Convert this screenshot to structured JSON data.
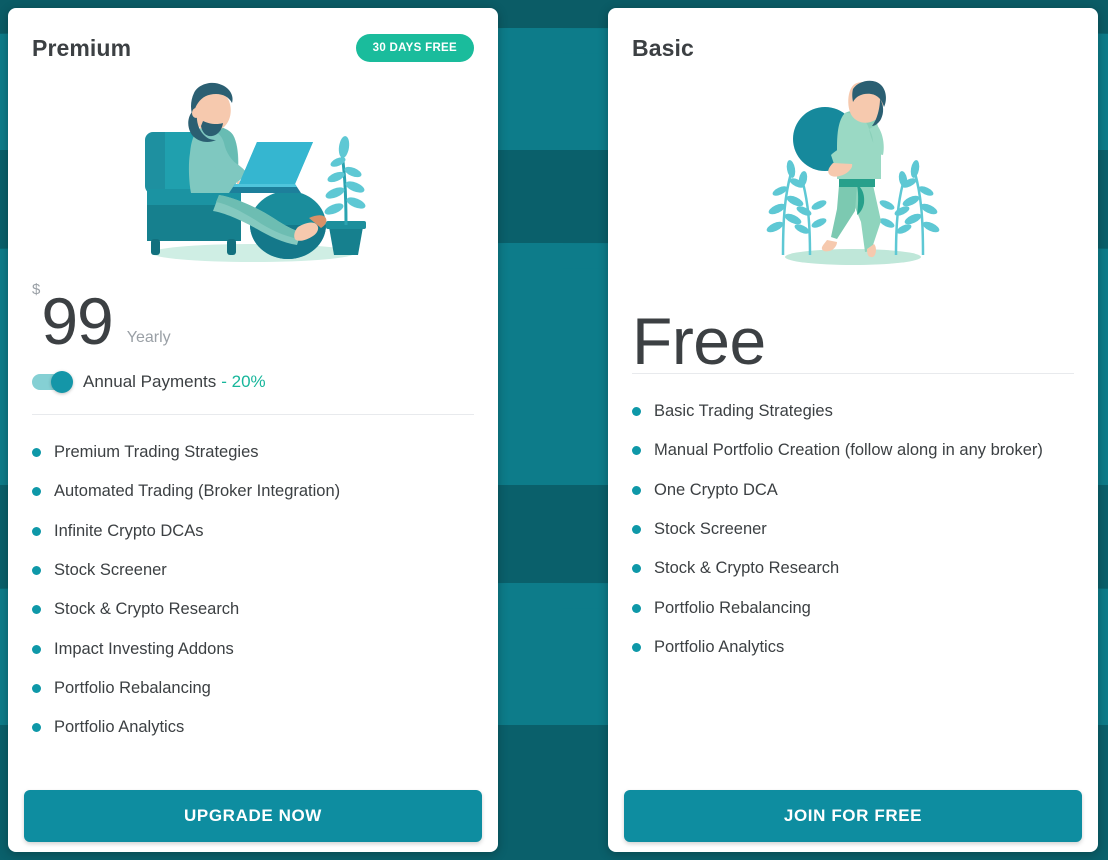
{
  "background": {
    "base_color": "#0b5c66",
    "band_light_color": "#0d7c8a",
    "band_dark_color": "#0a606b"
  },
  "theme": {
    "accent_teal": "#0e98a8",
    "badge_green": "#1abc9c",
    "button_teal": "#0e8da0",
    "discount_green": "#17b69b",
    "text_dark": "#3c4043",
    "text_muted": "#9aa0a6"
  },
  "plans": [
    {
      "id": "premium",
      "title": "Premium",
      "badge": "30 DAYS FREE",
      "illustration": "man-in-armchair-with-laptop-illustration",
      "price": {
        "currency": "$",
        "amount": "99",
        "period": "Yearly"
      },
      "toggle": {
        "label": "Annual Payments",
        "discount": "- 20%",
        "state": "on"
      },
      "features": [
        "Premium Trading Strategies",
        "Automated Trading (Broker Integration)",
        "Infinite Crypto DCAs",
        "Stock Screener",
        "Stock & Crypto Research",
        "Impact Investing Addons",
        "Portfolio Rebalancing",
        "Portfolio Analytics"
      ],
      "cta": "UPGRADE NOW"
    },
    {
      "id": "basic",
      "title": "Basic",
      "badge": null,
      "illustration": "person-carrying-ball-with-plants-illustration",
      "price": {
        "currency": "",
        "amount": "Free",
        "period": ""
      },
      "toggle": null,
      "features": [
        "Basic Trading Strategies",
        "Manual Portfolio Creation (follow along in any broker)",
        "One Crypto DCA",
        "Stock Screener",
        "Stock & Crypto Research",
        "Portfolio Rebalancing",
        "Portfolio Analytics"
      ],
      "cta": "JOIN FOR FREE"
    }
  ]
}
